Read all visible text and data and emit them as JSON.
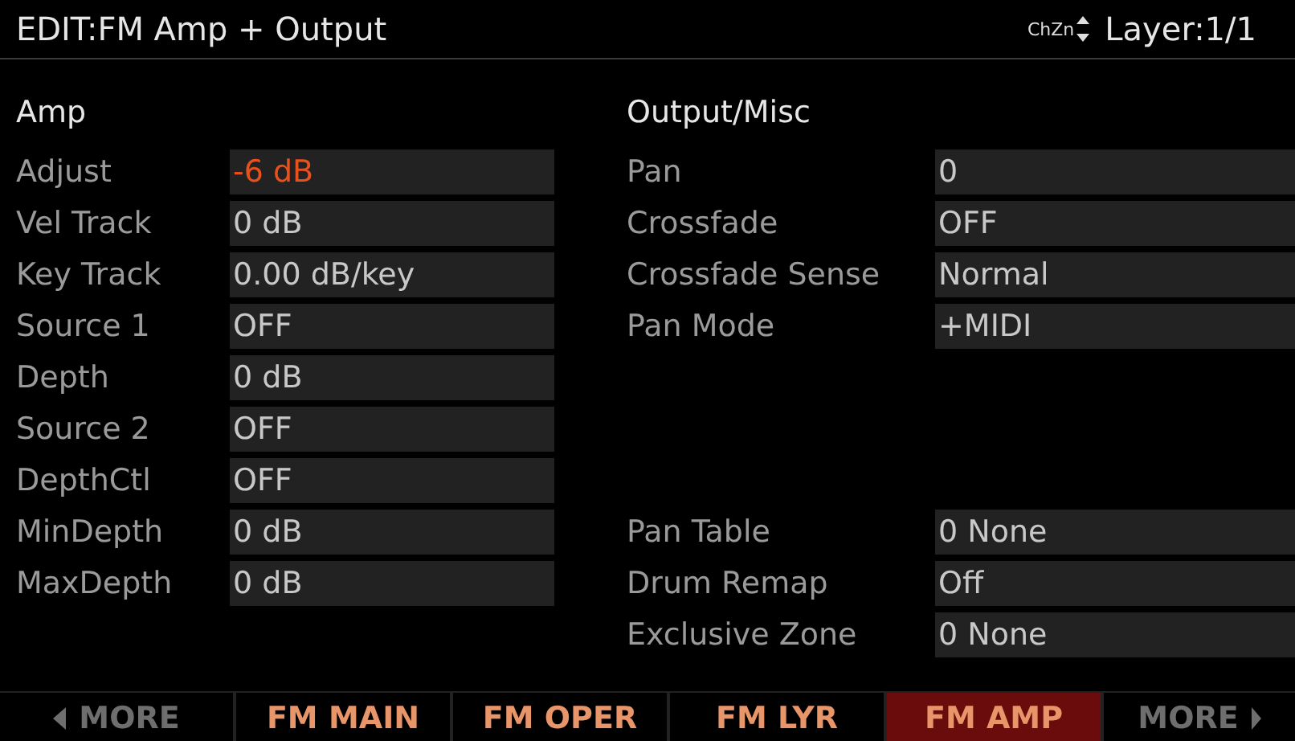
{
  "window": {
    "title": "EDIT:FM Amp + Output",
    "chzn": "ChZn",
    "layer": "Layer:1/1"
  },
  "amp": {
    "heading": "Amp",
    "fields": [
      {
        "label": "Adjust",
        "value": "-6 dB",
        "selected": true
      },
      {
        "label": "Vel Track",
        "value": "0 dB",
        "selected": false
      },
      {
        "label": "Key Track",
        "value": "0.00 dB/key",
        "selected": false
      },
      {
        "label": "Source 1",
        "value": "OFF",
        "selected": false
      },
      {
        "label": "Depth",
        "value": "0 dB",
        "selected": false
      },
      {
        "label": "Source 2",
        "value": "OFF",
        "selected": false
      },
      {
        "label": "DepthCtl",
        "value": "OFF",
        "selected": false
      },
      {
        "label": "MinDepth",
        "value": "0 dB",
        "selected": false
      },
      {
        "label": "MaxDepth",
        "value": "0 dB",
        "selected": false
      }
    ]
  },
  "output": {
    "heading": "Output/Misc",
    "fields": [
      {
        "label": "Pan",
        "value": "0",
        "selected": false
      },
      {
        "label": "Crossfade",
        "value": "OFF",
        "selected": false
      },
      {
        "label": "Crossfade Sense",
        "value": "Normal",
        "selected": false
      },
      {
        "label": "Pan Mode",
        "value": "+MIDI",
        "selected": false
      }
    ],
    "lower_fields": [
      {
        "label": "Pan Table",
        "value": "0 None",
        "selected": false
      },
      {
        "label": "Drum Remap",
        "value": "Off",
        "selected": false
      },
      {
        "label": "Exclusive Zone",
        "value": "0 None",
        "selected": false
      }
    ]
  },
  "tabs": [
    {
      "label": "MORE",
      "kind": "prev",
      "selected": false
    },
    {
      "label": "FM MAIN",
      "kind": "page",
      "selected": false
    },
    {
      "label": "FM OPER",
      "kind": "page",
      "selected": false
    },
    {
      "label": "FM LYR",
      "kind": "page",
      "selected": false
    },
    {
      "label": "FM AMP",
      "kind": "page",
      "selected": true
    },
    {
      "label": "MORE",
      "kind": "next",
      "selected": false
    }
  ]
}
